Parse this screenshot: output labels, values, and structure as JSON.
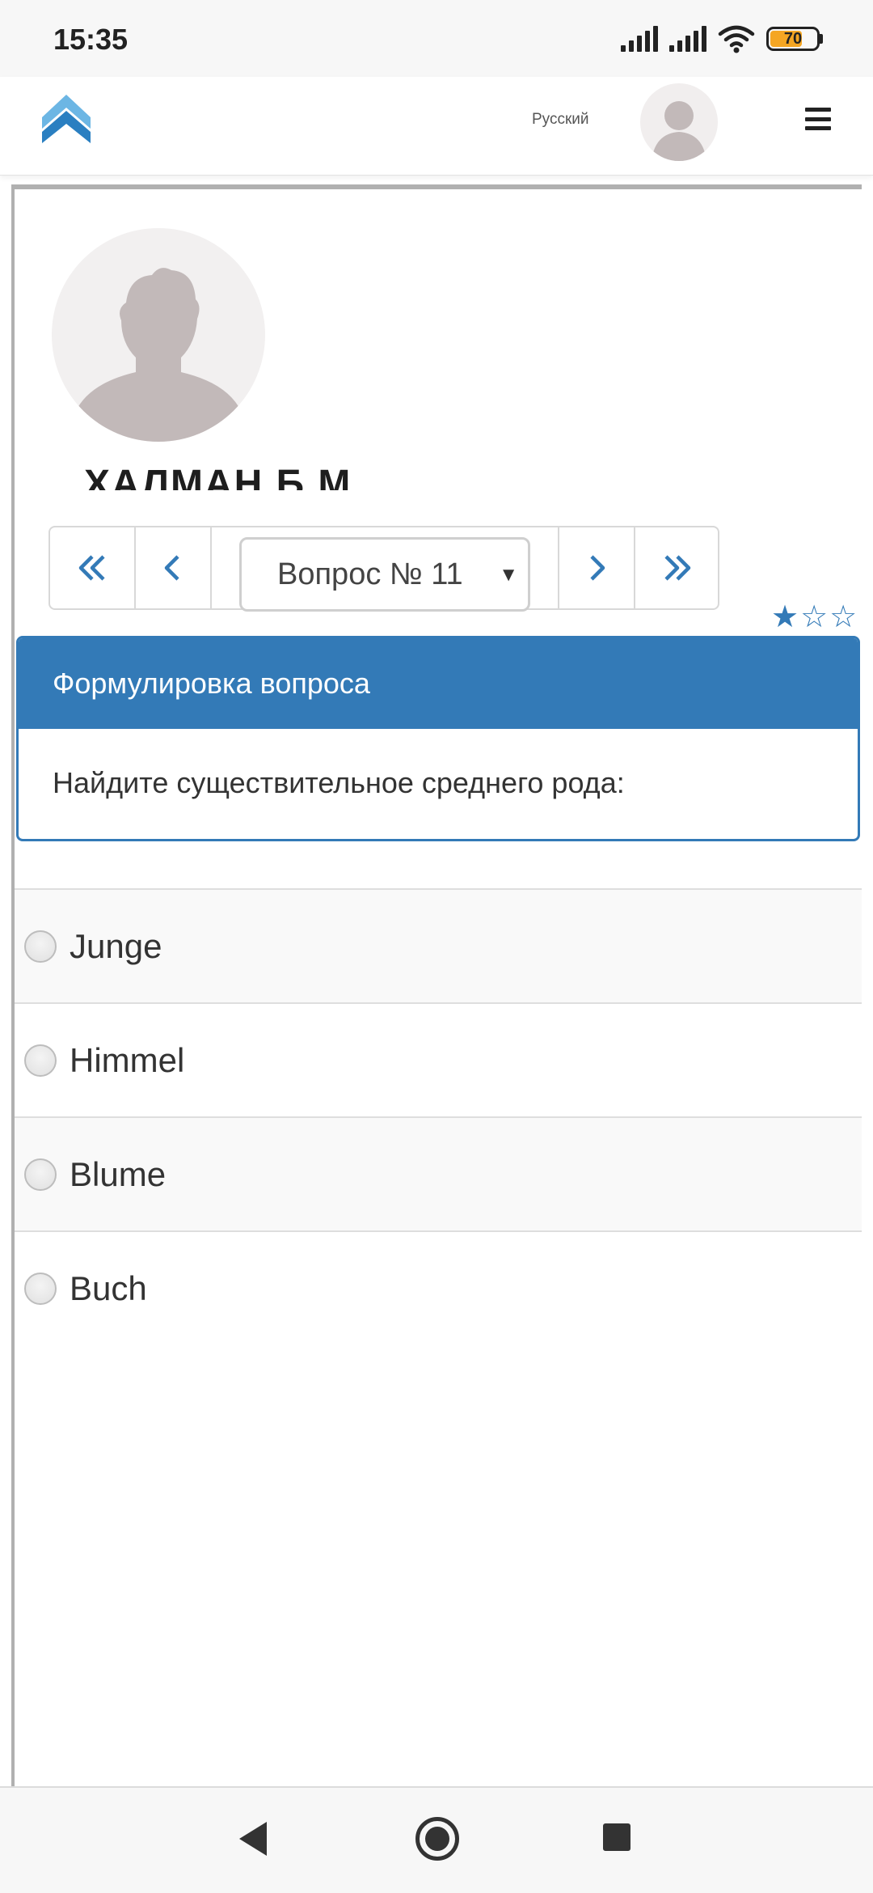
{
  "status_bar": {
    "time": "15:35",
    "battery": "70",
    "icons": [
      "signal-icon",
      "signal-icon",
      "wifi-icon",
      "battery-icon"
    ]
  },
  "top_nav": {
    "language": "Русский",
    "logo_icon": "logo-icon",
    "menu_icon": "hamburger-menu-icon"
  },
  "profile": {
    "name": "ХАЛМАН Б.М."
  },
  "pager": {
    "first_icon": "double-chevron-left-icon",
    "prev_icon": "chevron-left-icon",
    "next_icon": "chevron-right-icon",
    "last_icon": "double-chevron-right-icon",
    "question_select_value": "Вопрос № 11"
  },
  "difficulty": {
    "filled": 1,
    "total": 3
  },
  "question": {
    "header": "Формулировка вопроса",
    "text": "Найдите существительное среднего рода:"
  },
  "answers": [
    {
      "label": "Junge",
      "selected": false
    },
    {
      "label": "Himmel",
      "selected": false
    },
    {
      "label": "Blume",
      "selected": false
    },
    {
      "label": "Buch",
      "selected": false
    }
  ],
  "colors": {
    "accent": "#337ab7",
    "battery": "#f5a623"
  }
}
